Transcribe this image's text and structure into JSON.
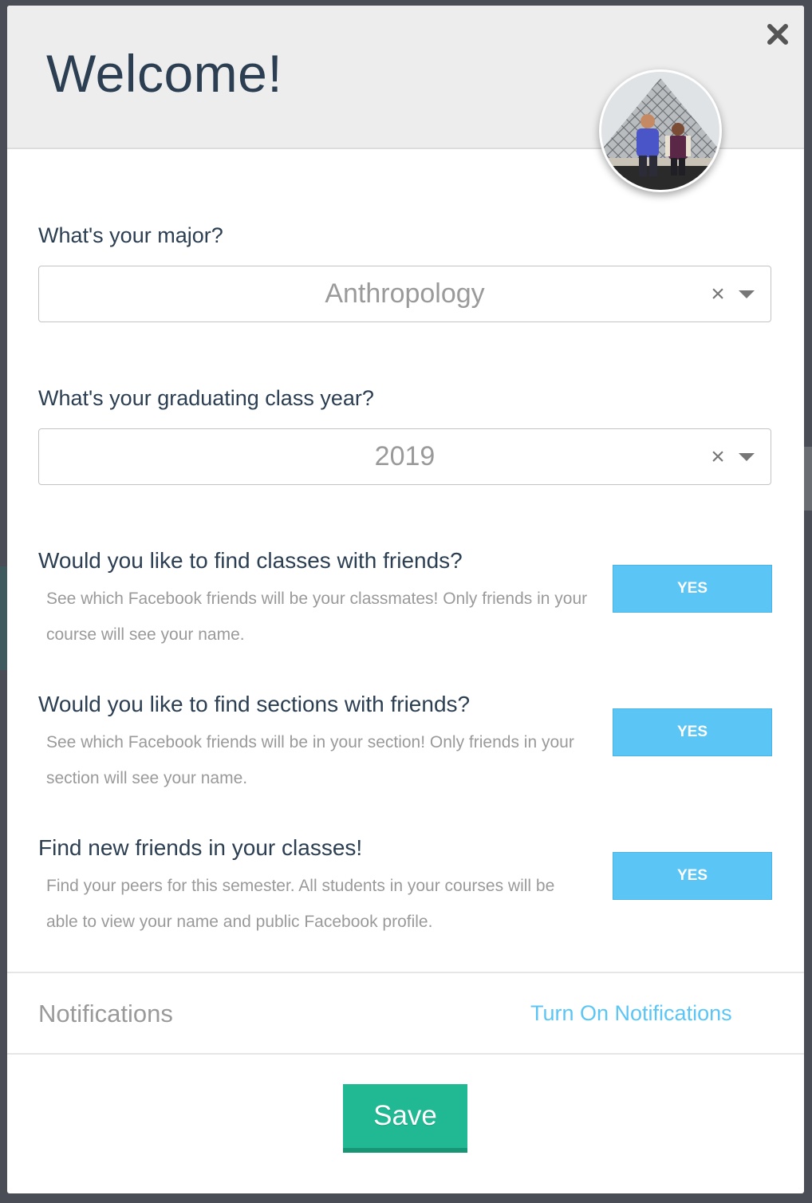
{
  "modal": {
    "title": "Welcome!",
    "close_icon": "close-icon",
    "avatar_icon": "user-avatar-photo"
  },
  "major": {
    "label": "What's your major?",
    "value": "Anthropology",
    "clear_glyph": "×"
  },
  "class_year": {
    "label": "What's your graduating class year?",
    "value": "2019",
    "clear_glyph": "×"
  },
  "options": [
    {
      "title": "Would you like to find classes with friends?",
      "description": "See which Facebook friends will be your classmates! Only friends in your course will see your name.",
      "button_label": "YES"
    },
    {
      "title": "Would you like to find sections with friends?",
      "description": "See which Facebook friends will be in your section! Only friends in your section will see your name.",
      "button_label": "YES"
    },
    {
      "title": "Find new friends in your classes!",
      "description": "Find your peers for this semester. All students in your courses will be able to view your name and public Facebook profile.",
      "button_label": "YES"
    }
  ],
  "notifications": {
    "label": "Notifications",
    "link_label": "Turn On Notifications"
  },
  "footer": {
    "save_label": "Save"
  },
  "colors": {
    "accent_blue": "#5bc6f6",
    "save_green": "#20b993",
    "title_navy": "#2b3e52",
    "header_gray": "#ededed"
  }
}
